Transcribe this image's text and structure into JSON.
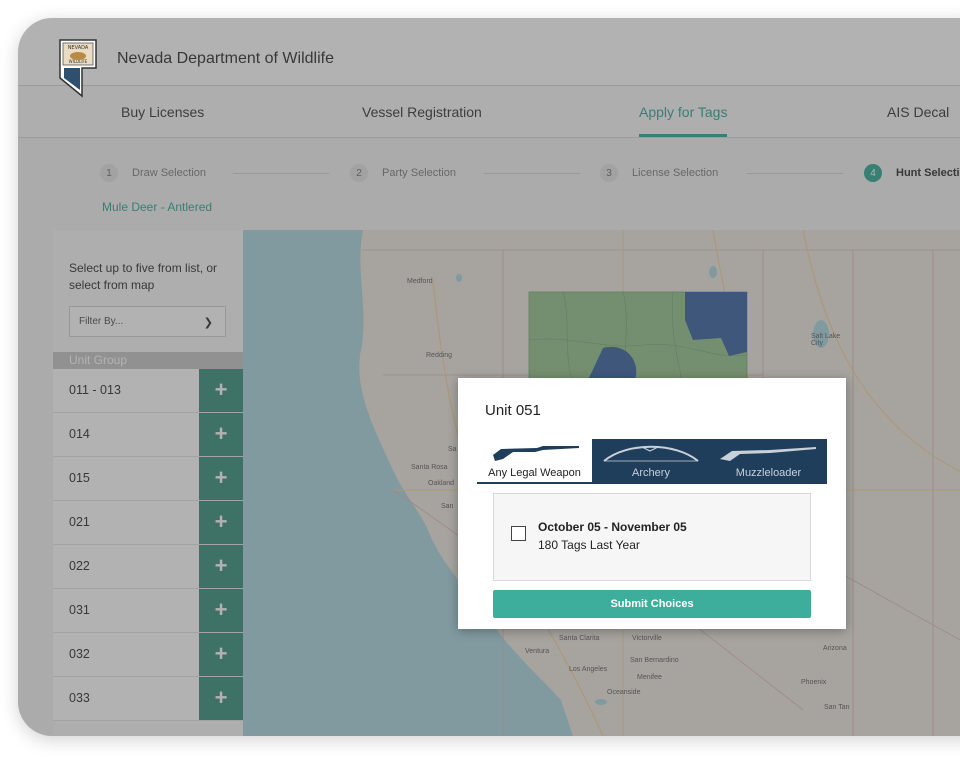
{
  "header": {
    "agency": "Nevada Department of Wildlife",
    "logo_text": [
      "NEVADA",
      "WILDLIFE"
    ]
  },
  "nav": {
    "items": [
      "Buy Licenses",
      "Vessel Registration",
      "Apply for Tags",
      "AIS Decal"
    ],
    "active": "Apply for Tags"
  },
  "stepper": {
    "steps": [
      {
        "num": "1",
        "label": "Draw Selection"
      },
      {
        "num": "2",
        "label": "Party Selection"
      },
      {
        "num": "3",
        "label": "License Selection"
      },
      {
        "num": "4",
        "label": "Hunt Selection"
      }
    ],
    "species": "Mule Deer - Antlered"
  },
  "sidebar": {
    "instructions": "Select up to five from list, or select from map",
    "filter_placeholder": "Filter By...",
    "group_header": "Unit Group",
    "units": [
      "011 - 013",
      "014",
      "015",
      "021",
      "022",
      "031",
      "032",
      "033"
    ],
    "add_symbol": "+"
  },
  "map": {
    "cities": [
      "Medford",
      "Redding",
      "Santa Rosa",
      "Oakland",
      "San",
      "Sa",
      "Salt Lake City",
      "Santa Clarita",
      "Victorville",
      "Ventura",
      "San Bernardino",
      "Los Angeles",
      "Menifee",
      "Oceanside",
      "Arizona",
      "Phoenix",
      "San Tan"
    ]
  },
  "modal": {
    "title": "Unit 051",
    "weapon_tabs": [
      "Any Legal Weapon",
      "Archery",
      "Muzzleloader"
    ],
    "active_tab": "Any Legal Weapon",
    "season": {
      "dates": "October 05 - November 05",
      "tags": "180 Tags Last Year"
    },
    "submit_label": "Submit Choices"
  },
  "colors": {
    "accent": "#22a38e",
    "add_button": "#2e8b77",
    "submit": "#3dae9c",
    "weapon_dark": "#1f3e5c",
    "unit_highlight": "#2d5a9b",
    "unit_region": "#8fbf86"
  }
}
